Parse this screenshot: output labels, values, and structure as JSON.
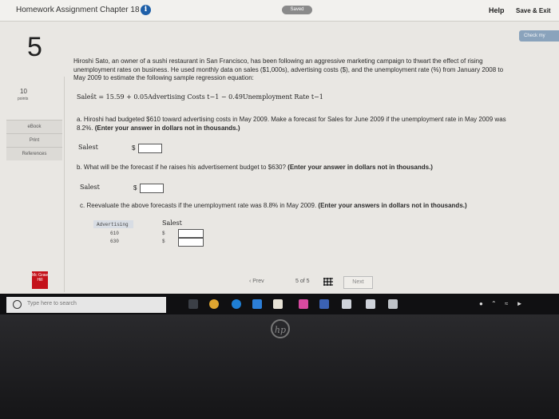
{
  "header": {
    "title": "Homework Assignment Chapter 18",
    "info_icon": "i",
    "status": "Saved",
    "help": "Help",
    "save_exit": "Save & Exit"
  },
  "check_button": "Check my",
  "question": {
    "number": "5",
    "points_value": "10",
    "points_label": "points",
    "side_tools": [
      "eBook",
      "Print",
      "References"
    ],
    "intro": "Hiroshi Sato, an owner of a sushi restaurant in San Francisco, has been following an aggressive marketing campaign to thwart the effect of rising unemployment rates on business. He used monthly data on sales ($1,000s), advertising costs ($), and the unemployment rate (%) from January 2008 to May 2009 to estimate the following sample regression equation:",
    "equation": "Saleŝt = 15.59 + 0.05Advertising Costs t−1 − 0.49Unemployment Rate t−1",
    "part_a": "a. Hiroshi had budgeted $610 toward advertising costs in May 2009. Make a forecast for Sales for June 2009 if the unemployment rate in May 2009 was 8.2%.",
    "part_a_instr": "(Enter your answer in dollars not in thousands.)",
    "part_b": "b. What will be the forecast if he raises his advertisement budget to $630?",
    "part_b_instr": "(Enter your answer in dollars not in thousands.)",
    "part_c": "c. Reevaluate the above forecasts if the unemployment rate was 8.8% in May 2009.",
    "part_c_instr": "(Enter your answers in dollars not in thousands.)",
    "sales_label": "Salest",
    "dollar": "$",
    "table": {
      "col_advertising": "Advertising",
      "col_sales": "Salest",
      "rows": [
        {
          "adv": "610",
          "dollar": "$"
        },
        {
          "adv": "630",
          "dollar": "$"
        }
      ]
    }
  },
  "pager": {
    "prev": "Prev",
    "current": "5",
    "of": "of",
    "total": "5",
    "next": "Next"
  },
  "logo": "Mc Graw Hill",
  "taskbar": {
    "search_placeholder": "Type here to search"
  },
  "device_logo": "hp"
}
